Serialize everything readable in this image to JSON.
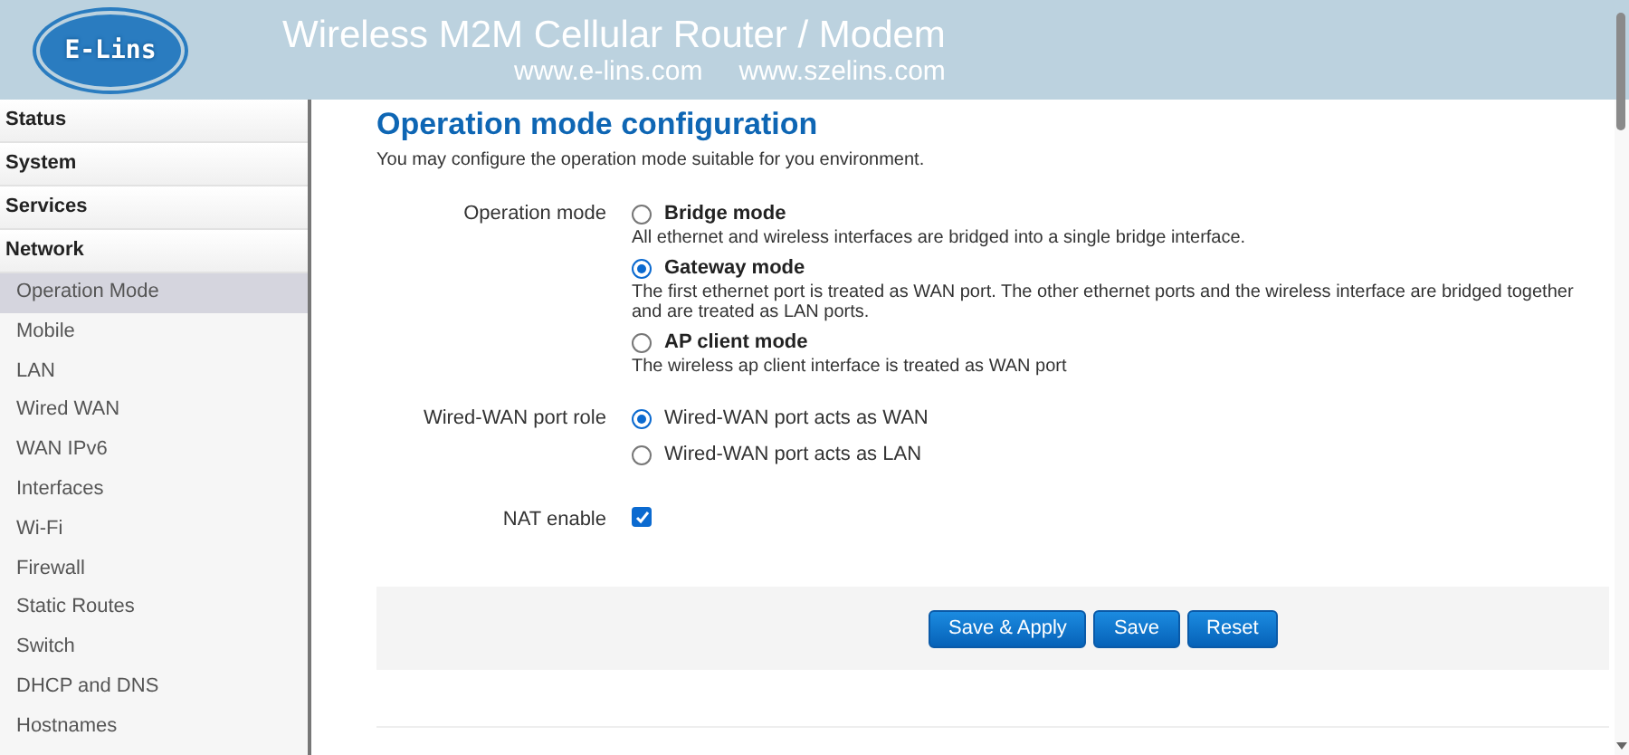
{
  "header": {
    "logo": "E-Lins",
    "title": "Wireless M2M Cellular Router / Modem",
    "urls": [
      "www.e-lins.com",
      "www.szelins.com"
    ]
  },
  "sidebar": [
    {
      "label": "Status",
      "kind": "section",
      "selected": false
    },
    {
      "label": "System",
      "kind": "section",
      "selected": false
    },
    {
      "label": "Services",
      "kind": "section",
      "selected": false
    },
    {
      "label": "Network",
      "kind": "section",
      "selected": false
    },
    {
      "label": "Operation Mode",
      "kind": "item",
      "selected": true
    },
    {
      "label": "Mobile",
      "kind": "item",
      "selected": false
    },
    {
      "label": "LAN",
      "kind": "item",
      "selected": false
    },
    {
      "label": "Wired WAN",
      "kind": "item",
      "selected": false
    },
    {
      "label": "WAN IPv6",
      "kind": "item",
      "selected": false
    },
    {
      "label": "Interfaces",
      "kind": "item",
      "selected": false
    },
    {
      "label": "Wi-Fi",
      "kind": "item",
      "selected": false
    },
    {
      "label": "Firewall",
      "kind": "item",
      "selected": false
    },
    {
      "label": "Static Routes",
      "kind": "item",
      "selected": false
    },
    {
      "label": "Switch",
      "kind": "item",
      "selected": false
    },
    {
      "label": "DHCP and DNS",
      "kind": "item",
      "selected": false
    },
    {
      "label": "Hostnames",
      "kind": "item",
      "selected": false
    }
  ],
  "content": {
    "title": "Operation mode configuration",
    "description": "You may configure the operation mode suitable for you environment.",
    "fields": [
      {
        "label": "Operation mode",
        "kind": "radio",
        "options": [
          {
            "label": "Bridge mode",
            "description": "All ethernet and wireless interfaces are bridged into a single bridge interface.",
            "selected": false
          },
          {
            "label": "Gateway mode",
            "description": "The first ethernet port is treated as WAN port. The other ethernet ports and the wireless interface are bridged together and are treated as LAN ports.",
            "selected": true
          },
          {
            "label": "AP client mode",
            "description": "The wireless ap client interface is treated as WAN port",
            "selected": false
          }
        ]
      },
      {
        "label": "Wired-WAN port role",
        "kind": "radio",
        "options": [
          {
            "label": "Wired-WAN port acts as WAN",
            "selected": true
          },
          {
            "label": "Wired-WAN port acts as LAN",
            "selected": false
          }
        ]
      },
      {
        "label": "NAT enable",
        "kind": "checkbox",
        "checked": true
      }
    ]
  },
  "buttons": [
    "Save & Apply",
    "Save",
    "Reset"
  ]
}
